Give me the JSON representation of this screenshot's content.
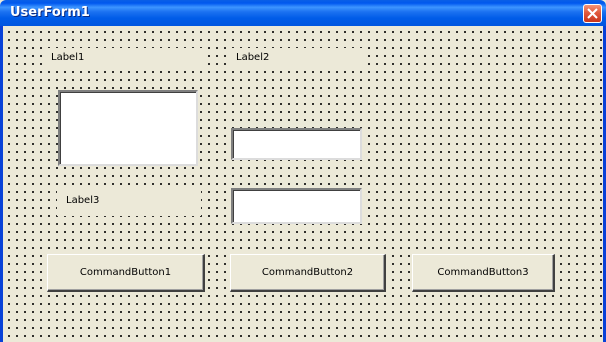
{
  "window": {
    "title": "UserForm1"
  },
  "labels": {
    "label1": "Label1",
    "label2": "Label2",
    "label3": "Label3"
  },
  "textboxes": {
    "textbox1": {
      "value": ""
    },
    "textbox2": {
      "value": ""
    },
    "textbox3": {
      "value": ""
    }
  },
  "buttons": {
    "button1": "CommandButton1",
    "button2": "CommandButton2",
    "button3": "CommandButton3"
  },
  "icons": {
    "close": "close-icon"
  },
  "colors": {
    "titlebar": "#0058ee",
    "form_background": "#ece9d8",
    "close_button": "#e05a3d"
  }
}
